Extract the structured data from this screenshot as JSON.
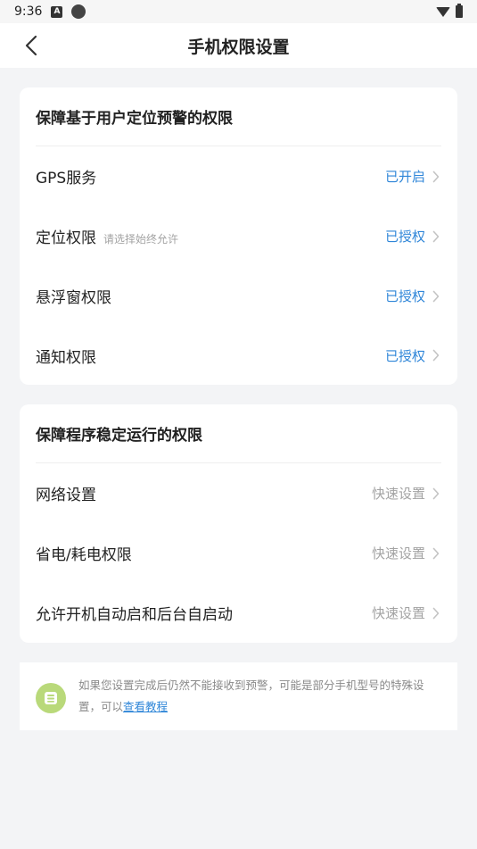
{
  "statusbar": {
    "time": "9:36",
    "a_glyph": "A"
  },
  "header": {
    "title": "手机权限设置"
  },
  "section1": {
    "title": "保障基于用户定位预警的权限",
    "rows": [
      {
        "label": "GPS服务",
        "hint": "",
        "status": "已开启"
      },
      {
        "label": "定位权限",
        "hint": "请选择始终允许",
        "status": "已授权"
      },
      {
        "label": "悬浮窗权限",
        "hint": "",
        "status": "已授权"
      },
      {
        "label": "通知权限",
        "hint": "",
        "status": "已授权"
      }
    ]
  },
  "section2": {
    "title": "保障程序稳定运行的权限",
    "rows": [
      {
        "label": "网络设置",
        "status": "快速设置"
      },
      {
        "label": "省电/耗电权限",
        "status": "快速设置"
      },
      {
        "label": "允许开机自动启和后台自启动",
        "status": "快速设置"
      }
    ]
  },
  "notice": {
    "text": "如果您设置完成后仍然不能接收到预警，可能是部分手机型号的特殊设置，可以",
    "link": "查看教程"
  },
  "colors": {
    "accent": "#2f86d8",
    "muted": "#a3a3a3",
    "icon_bg": "#b9d97a"
  }
}
